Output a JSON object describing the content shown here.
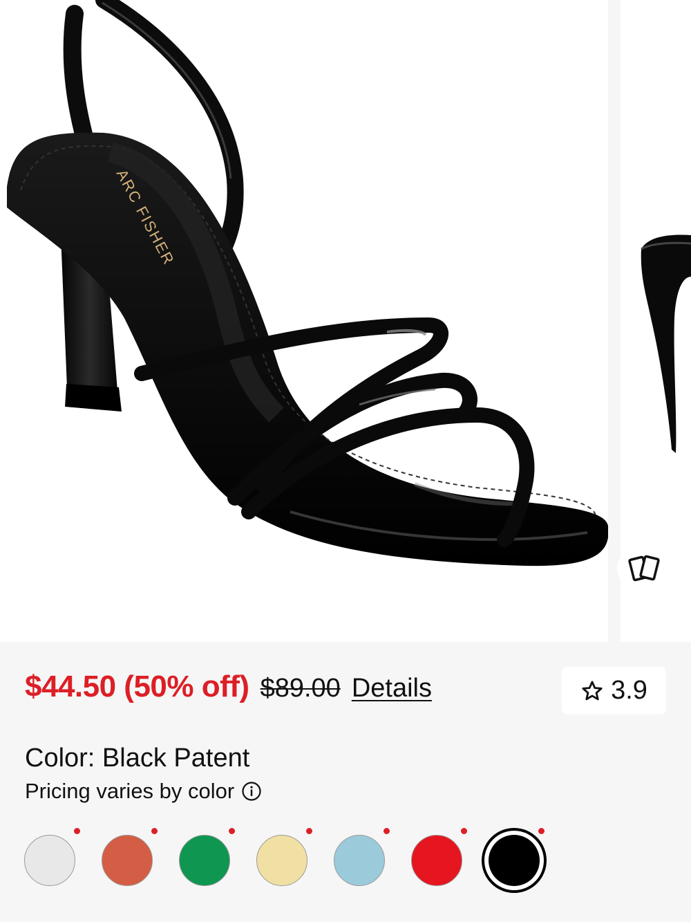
{
  "gallery": {
    "brand_print": "ARC FISHER",
    "view_toggle_icon": "cards-icon"
  },
  "price": {
    "sale": "$44.50 (50% off)",
    "original": "$89.00",
    "details_link": "Details"
  },
  "rating": {
    "icon": "star-outline-icon",
    "value": "3.9"
  },
  "color": {
    "label": "Color: Black Patent",
    "pricing_note": "Pricing varies by color",
    "info_icon": "info-icon"
  },
  "swatches": [
    {
      "name": "white",
      "color": "#e8e8e8",
      "sale": true,
      "selected": false
    },
    {
      "name": "rust",
      "color": "#d45e45",
      "sale": true,
      "selected": false
    },
    {
      "name": "green",
      "color": "#0f9650",
      "sale": true,
      "selected": false
    },
    {
      "name": "butter",
      "color": "#f1e0a3",
      "sale": true,
      "selected": false
    },
    {
      "name": "light-blue",
      "color": "#9bcadb",
      "sale": true,
      "selected": false
    },
    {
      "name": "red",
      "color": "#e5161f",
      "sale": true,
      "selected": false
    },
    {
      "name": "black",
      "color": "#000000",
      "sale": true,
      "selected": true
    }
  ],
  "colors": {
    "sale_red": "#dc1f26",
    "background": "#f6f6f6",
    "card": "#ffffff"
  }
}
